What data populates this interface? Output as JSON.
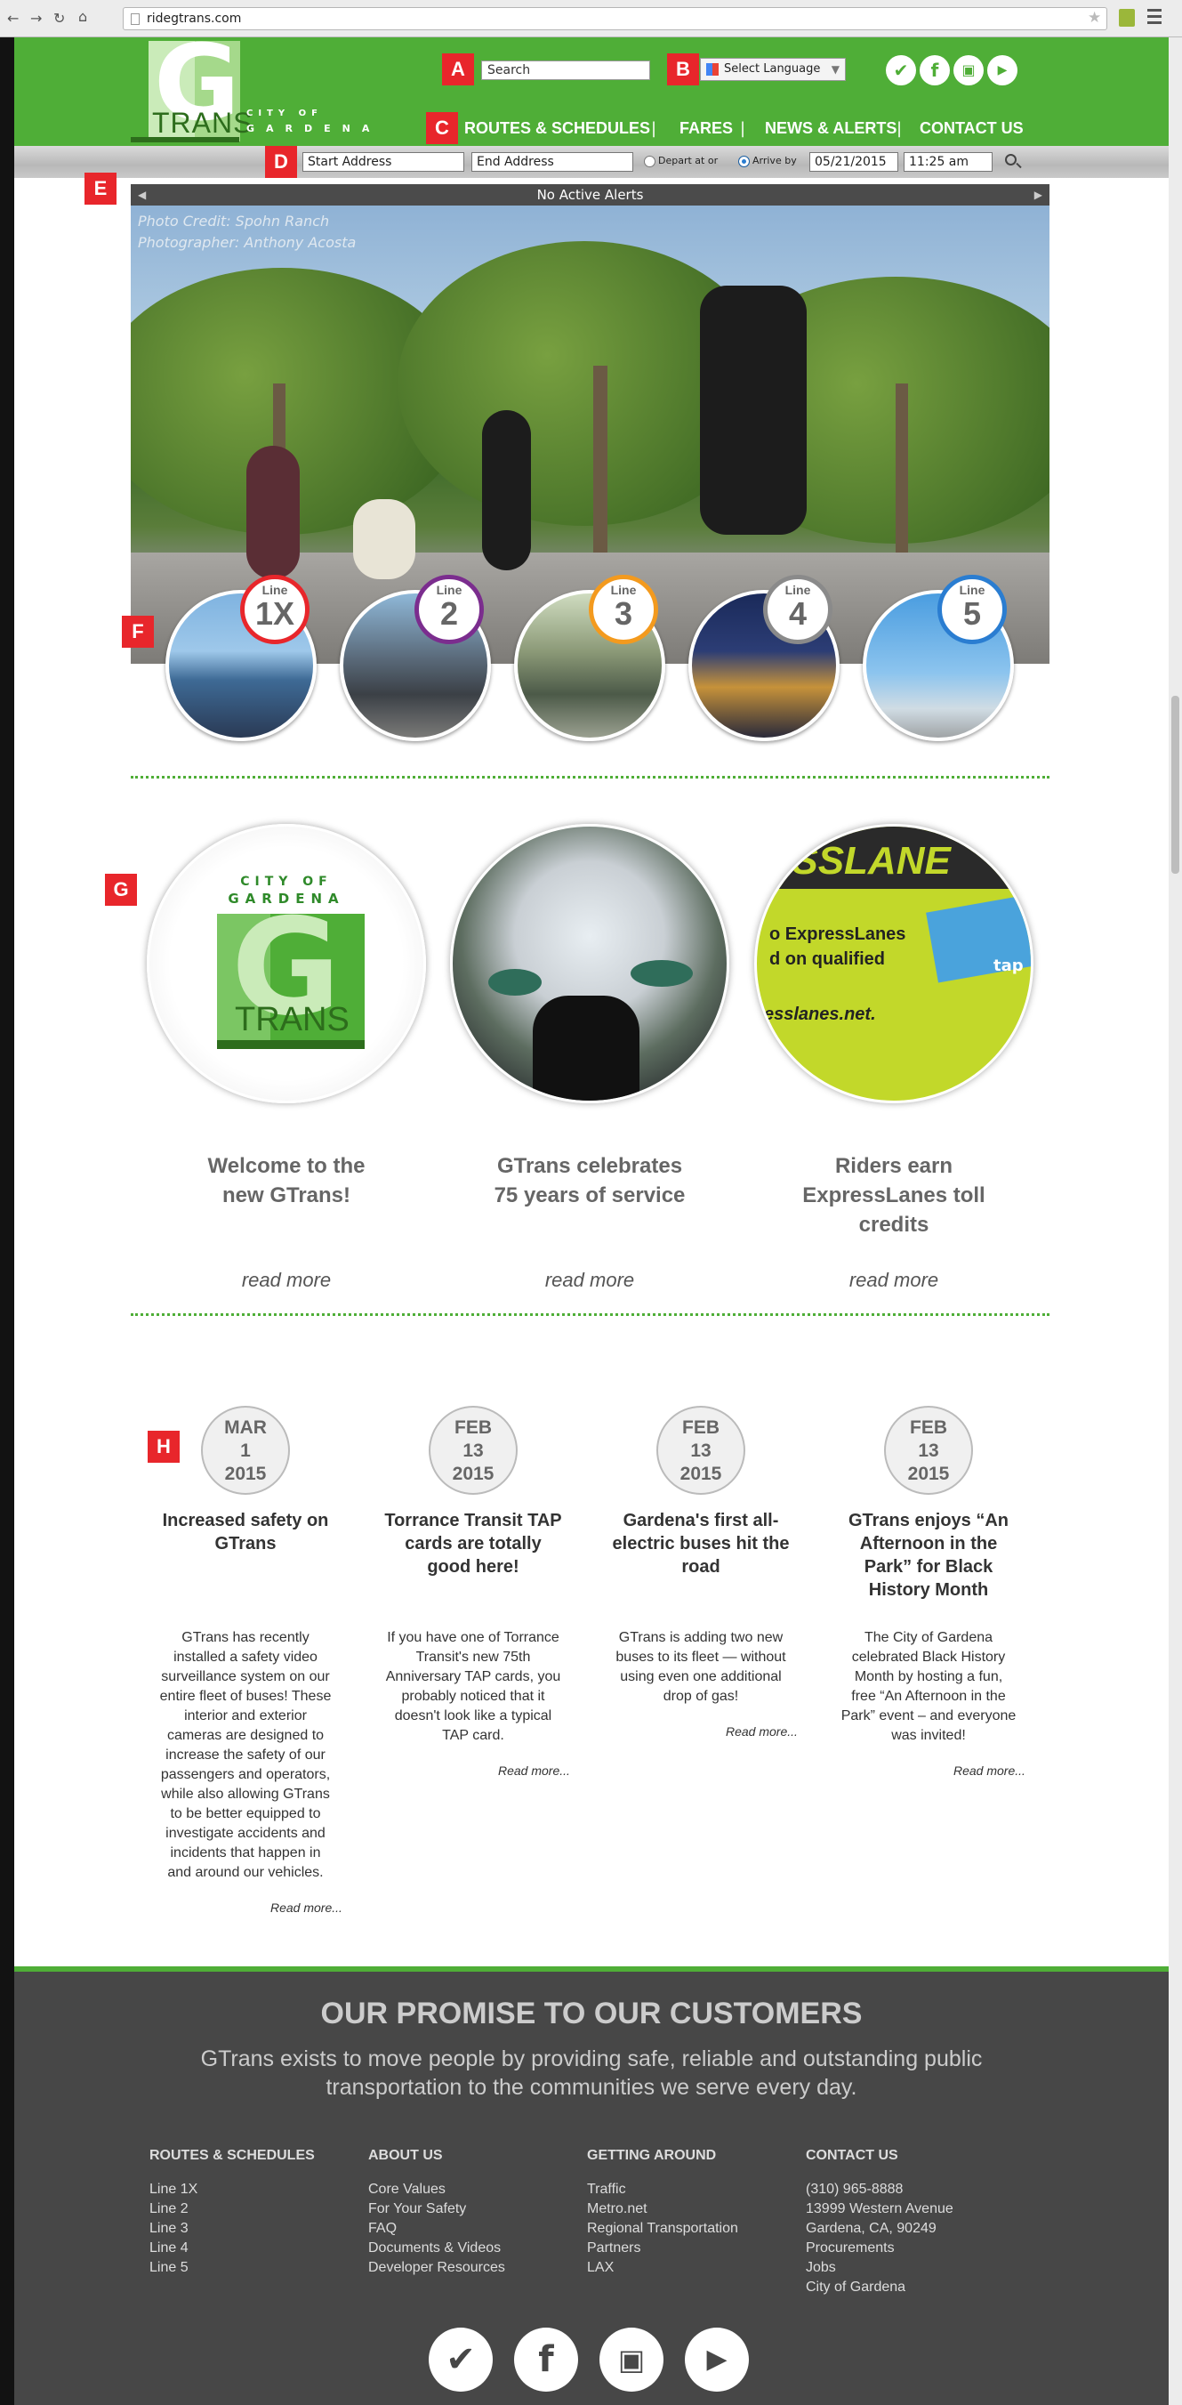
{
  "browser": {
    "url": "ridegtrans.com"
  },
  "header": {
    "logo": {
      "g": "G",
      "trans": "TRANS",
      "city_of": "CITY OF",
      "gardena": "GARDENA"
    },
    "search_placeholder": "Search",
    "language": "Select Language",
    "social": [
      "twitter-icon",
      "facebook-icon",
      "instagram-icon",
      "youtube-icon"
    ],
    "nav": [
      "ROUTES & SCHEDULES",
      "FARES",
      "NEWS & ALERTS",
      "CONTACT US"
    ]
  },
  "annotations": [
    "A",
    "B",
    "C",
    "D",
    "E",
    "F",
    "G",
    "H"
  ],
  "trip": {
    "start": "Start Address",
    "end": "End Address",
    "depart": "Depart at or",
    "arrive": "Arrive by",
    "date": "05/21/2015",
    "time": "11:25 am"
  },
  "alerts": "No Active Alerts",
  "hero": {
    "credit1": "Photo Credit: Spohn Ranch",
    "credit2": "Photographer: Anthony Acosta"
  },
  "lines": [
    {
      "word": "Line",
      "num": "1X",
      "color": "#e8262b"
    },
    {
      "word": "Line",
      "num": "2",
      "color": "#7b2d8e"
    },
    {
      "word": "Line",
      "num": "3",
      "color": "#f39a1e"
    },
    {
      "word": "Line",
      "num": "4",
      "color": "#8a8a8a"
    },
    {
      "word": "Line",
      "num": "5",
      "color": "#2a7dd1"
    }
  ],
  "features": [
    {
      "title1": "Welcome to the",
      "title2": "new GTrans!",
      "title3": "",
      "more": "read more"
    },
    {
      "title1": "GTrans celebrates",
      "title2": "75 years of service",
      "title3": "",
      "more": "read more"
    },
    {
      "title1": "Riders earn",
      "title2": "ExpressLanes toll",
      "title3": "credits",
      "more": "read more"
    }
  ],
  "feature_art": {
    "city": "CITY OF",
    "gardena": "GARDENA",
    "g": "G",
    "trans": "TRANS",
    "el1": "ESSLANE",
    "el2": "o ExpressLanes",
    "el3": "d on qualified",
    "el4": "esslanes.net.",
    "el5": "tap"
  },
  "news": [
    {
      "m": "MAR",
      "d": "1",
      "y": "2015",
      "title": [
        "Increased safety on",
        "GTrans"
      ],
      "body": [
        "GTrans has recently",
        "installed a safety video",
        "surveillance system on our",
        "entire fleet of buses! These",
        "interior and exterior",
        "cameras are designed to",
        "increase the safety of our",
        "passengers and operators,",
        "while also allowing GTrans",
        "to be better equipped to",
        "investigate accidents and",
        "incidents that happen in",
        "and around our vehicles."
      ],
      "more": "Read more..."
    },
    {
      "m": "FEB",
      "d": "13",
      "y": "2015",
      "title": [
        "Torrance Transit TAP",
        "cards are totally",
        "good here!"
      ],
      "body": [
        "If you have one of Torrance",
        "Transit's new 75th",
        "Anniversary TAP cards, you",
        "probably noticed that it",
        "doesn't look like a typical",
        "TAP card."
      ],
      "more": "Read more..."
    },
    {
      "m": "FEB",
      "d": "13",
      "y": "2015",
      "title": [
        "Gardena's first all-",
        "electric buses hit the",
        "road"
      ],
      "body": [
        "GTrans is adding two new",
        "buses to its fleet — without",
        "using even one additional",
        "drop of gas!"
      ],
      "more": "Read more..."
    },
    {
      "m": "FEB",
      "d": "13",
      "y": "2015",
      "title": [
        "GTrans enjoys “An",
        "Afternoon in the",
        "Park” for Black",
        "History Month"
      ],
      "body": [
        "The City of Gardena",
        "celebrated Black History",
        "Month by hosting a fun,",
        "free “An Afternoon in the",
        "Park” event – and everyone",
        "was invited!"
      ],
      "more": "Read more..."
    }
  ],
  "footer": {
    "promise_title": "OUR PROMISE TO OUR CUSTOMERS",
    "promise_1": "GTrans exists to move people by providing safe, reliable and outstanding public",
    "promise_2": "transportation to the communities we serve every day.",
    "cols": [
      {
        "head": "ROUTES & SCHEDULES",
        "items": [
          "Line 1X",
          "Line 2",
          "Line 3",
          "Line 4",
          "Line 5"
        ]
      },
      {
        "head": "ABOUT US",
        "items": [
          "Core Values",
          "For Your Safety",
          "FAQ",
          "Documents & Videos",
          "Developer Resources"
        ]
      },
      {
        "head": "GETTING AROUND",
        "items": [
          "Traffic",
          "Metro.net",
          "Regional Transportation",
          "Partners",
          "LAX"
        ]
      },
      {
        "head": "CONTACT US",
        "items": [
          "(310) 965-8888",
          "13999 Western Avenue",
          "Gardena, CA, 90249",
          "Procurements",
          "Jobs",
          "City of Gardena"
        ]
      }
    ],
    "social": [
      "twitter-icon",
      "facebook-icon",
      "instagram-icon",
      "youtube-icon"
    ]
  }
}
